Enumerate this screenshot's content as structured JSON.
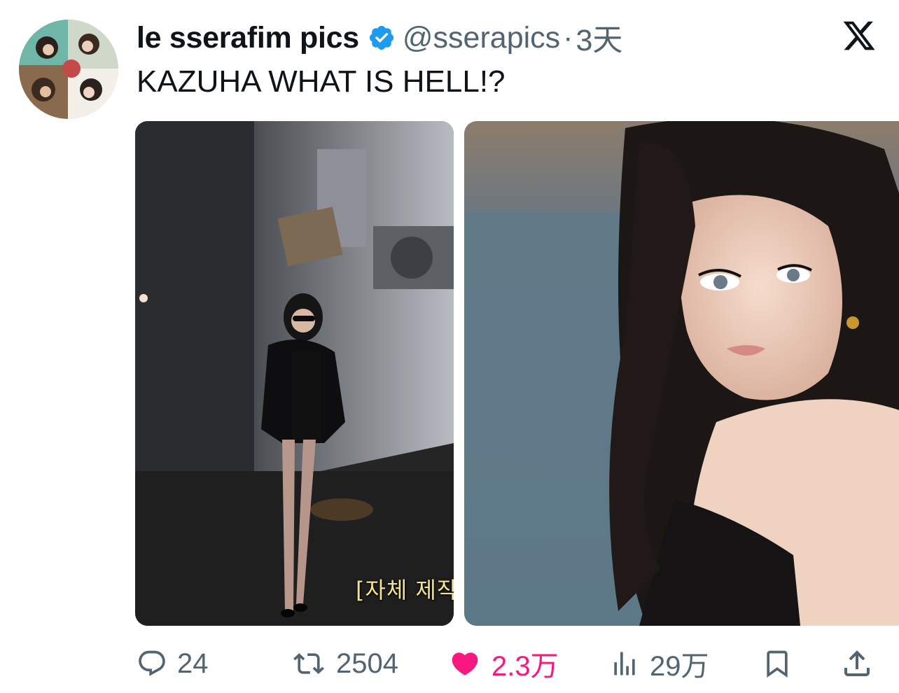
{
  "tweet": {
    "display_name": "le sserafim pics",
    "handle": "@sserapics",
    "separator": "·",
    "time": "3天",
    "text": "KAZUHA WHAT IS HELL!?"
  },
  "media": {
    "subtitle_text": "[자체 제작"
  },
  "actions": {
    "replies": "24",
    "retweets": "2504",
    "likes": "2.3万",
    "views": "29万"
  },
  "colors": {
    "verified": "#1d9bf0",
    "like": "#f91880",
    "muted": "#536471"
  },
  "icons": [
    "avatar-image",
    "verified-badge-icon",
    "x-logo-icon",
    "reply-icon",
    "retweet-icon",
    "like-icon",
    "views-icon",
    "bookmark-icon",
    "share-icon"
  ]
}
